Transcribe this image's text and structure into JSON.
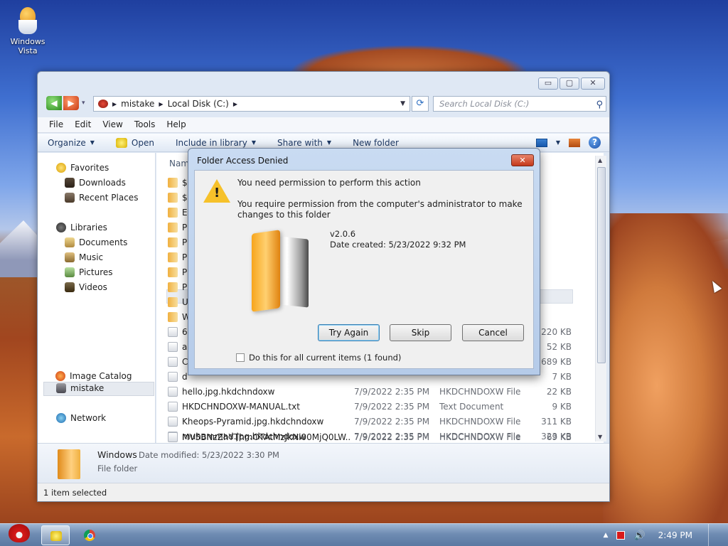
{
  "desktop": {
    "icon_label": "Windows\nVista",
    "icon_line1": "Windows",
    "icon_line2": "Vista"
  },
  "explorer": {
    "caption_minimize": "▭",
    "caption_maximize": "▢",
    "caption_close": "✕",
    "breadcrumb": [
      "mistake",
      "Local Disk (C:)"
    ],
    "search_placeholder": "Search Local Disk (C:)",
    "menu": [
      "File",
      "Edit",
      "View",
      "Tools",
      "Help"
    ],
    "commands": {
      "organize": "Organize",
      "open": "Open",
      "include": "Include in library",
      "share": "Share with",
      "newfolder": "New folder"
    },
    "nav": {
      "favorites": "Favorites",
      "downloads": "Downloads",
      "recent": "Recent Places",
      "libraries": "Libraries",
      "documents": "Documents",
      "music": "Music",
      "pictures": "Pictures",
      "videos": "Videos",
      "user": "mistake",
      "network": "Network",
      "image_catalog": "Image Catalog"
    },
    "column_name": "Nam",
    "folder_rows": [
      "$",
      "$",
      "E",
      "P",
      "P",
      "P",
      "P",
      "P",
      "U",
      "W"
    ],
    "partial_rows": [
      {
        "name": "6",
        "size": "2,220 KB"
      },
      {
        "name": "a",
        "size": "52 KB"
      },
      {
        "name": "C",
        "size": "689 KB"
      },
      {
        "name": "d",
        "size": "7 KB"
      }
    ],
    "files": [
      {
        "name": "hello.jpg.hkdchndoxw",
        "date": "7/9/2022 2:35 PM",
        "type": "HKDCHNDOXW File",
        "size": "22 KB"
      },
      {
        "name": "HKDCHNDOXW-MANUAL.txt",
        "date": "7/9/2022 2:35 PM",
        "type": "Text Document",
        "size": "9 KB"
      },
      {
        "name": "Kheops-Pyramid.jpg.hkdchndoxw",
        "date": "7/9/2022 2:35 PM",
        "type": "HKDCHNDOXW File",
        "size": "311 KB"
      },
      {
        "name": "muhammad.jpg.hkdchndoxw",
        "date": "7/9/2022 2:35 PM",
        "type": "HKDCHNDOXW File",
        "size": "323 KB"
      },
      {
        "name": "MV5BNzZhYThmOTAtMzJkNi00MjQ0LW...",
        "date": "7/9/2022 2:35 PM",
        "type": "HKDCHNDOXW File",
        "size": "69 KB"
      }
    ],
    "details": {
      "name": "Windows",
      "modified": "Date modified: 5/23/2022 3:30 PM",
      "type": "File folder"
    },
    "status": "1 item selected"
  },
  "dialog": {
    "title": "Folder Access Denied",
    "close": "✕",
    "heading": "You need permission to perform this action",
    "message": "You require permission from the computer's administrator to make changes to this folder",
    "version": "v2.0.6",
    "date_created": "Date created: 5/23/2022 9:32 PM",
    "buttons": {
      "try_again": "Try Again",
      "skip": "Skip",
      "cancel": "Cancel"
    },
    "checkbox_label": "Do this for all current items (1 found)"
  },
  "taskbar": {
    "clock": "2:49 PM"
  }
}
